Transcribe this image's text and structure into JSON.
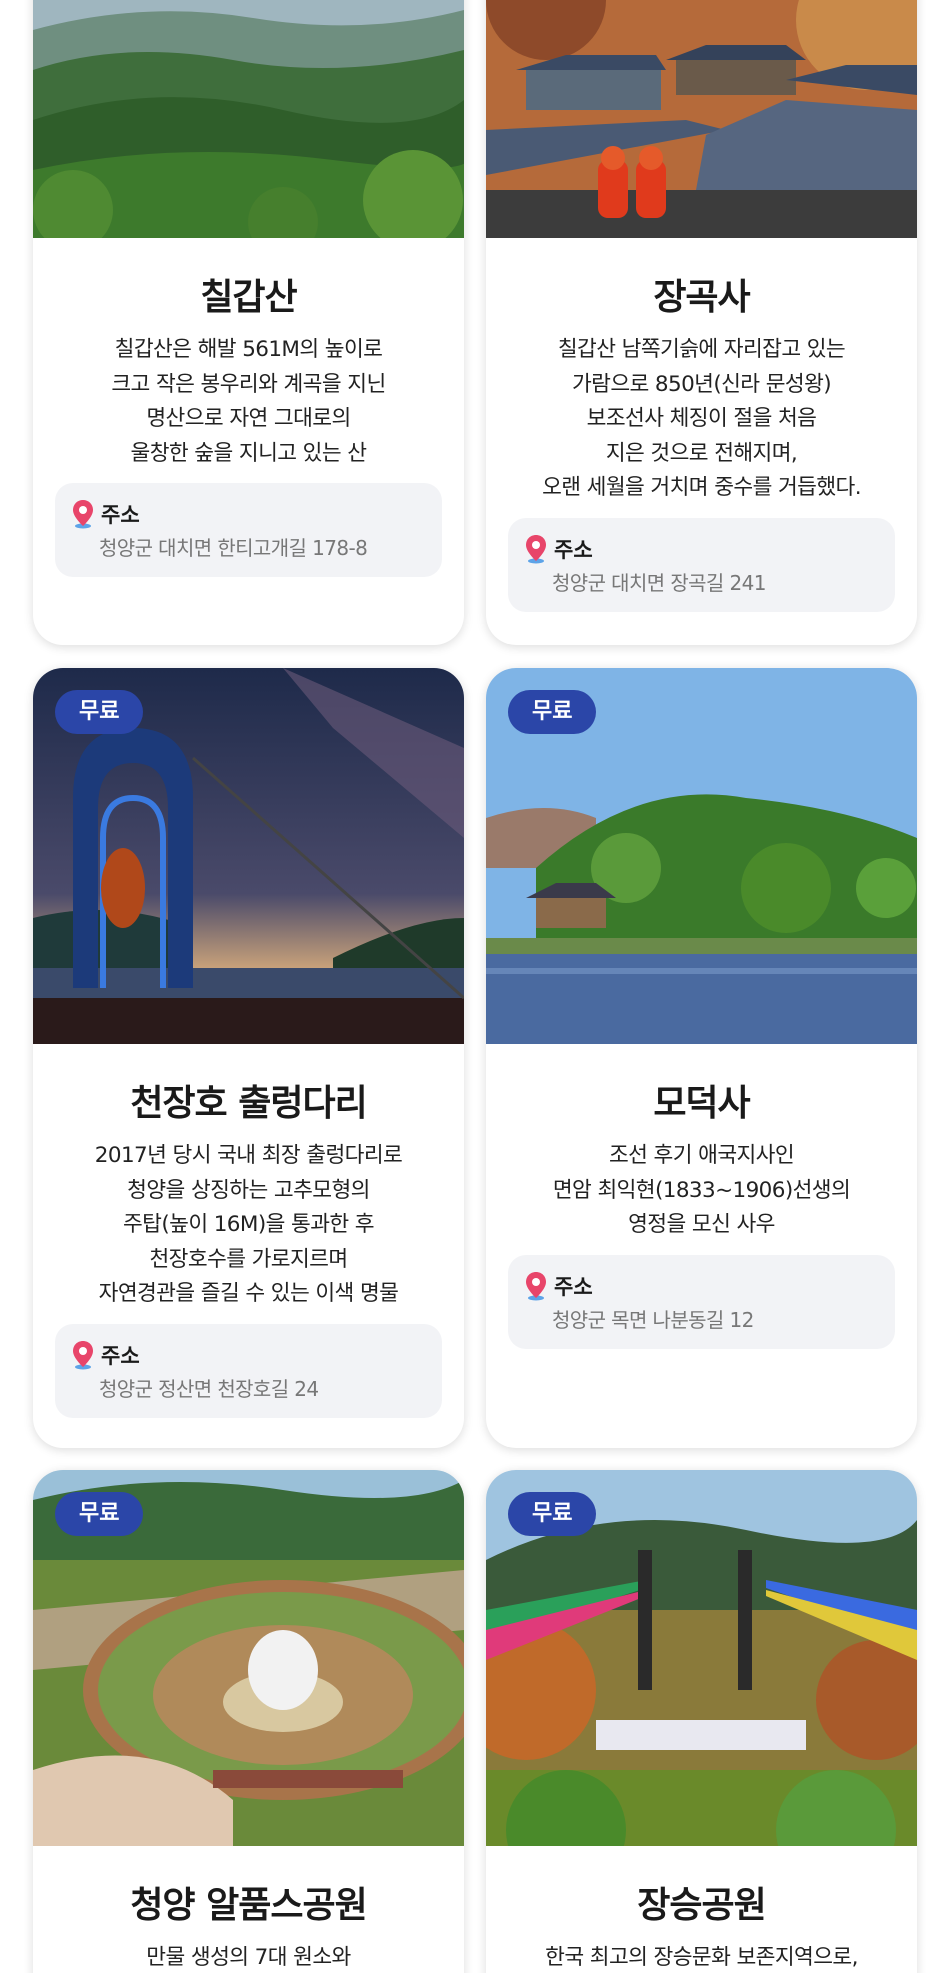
{
  "address_label": "주소",
  "colors": {
    "badge": "#2b46a8",
    "pin": "#e8456a",
    "address_bg": "#f2f3f6"
  },
  "cards": [
    {
      "title": "칠갑산",
      "desc": [
        "칠갑산은 해발 561M의 높이로",
        "크고 작은 봉우리와 계곡을 지닌",
        "명산으로 자연 그대로의",
        "울창한 숲을 지니고 있는 산"
      ],
      "address": "청양군 대치면 한티고개길 178-8"
    },
    {
      "title": "장곡사",
      "desc": [
        "칠갑산 남쪽기슭에 자리잡고 있는",
        "가람으로 850년(신라 문성왕)",
        "보조선사 체징이 절을 처음",
        "지은 것으로 전해지며,",
        "오랜 세월을 거치며 중수를 거듭했다."
      ],
      "address": "청양군 대치면 장곡길 241"
    },
    {
      "badge": "무료",
      "title": "천장호 출렁다리",
      "desc": [
        "2017년 당시 국내 최장 출렁다리로",
        "청양을 상징하는 고추모형의",
        "주탑(높이 16M)을 통과한 후",
        "천장호수를 가로지르며",
        "자연경관을 즐길 수 있는 이색 명물"
      ],
      "address": "청양군 정산면 천장호길 24"
    },
    {
      "badge": "무료",
      "title": "모덕사",
      "desc": [
        "조선 후기 애국지사인",
        "면암 최익현(1833~1906)선생의",
        "영정을 모신 사우"
      ],
      "address": "청양군 목면 나분동길 12"
    },
    {
      "badge": "무료",
      "title": "청양 알품스공원",
      "desc": [
        "만물 생성의 7대 원소와"
      ]
    },
    {
      "badge": "무료",
      "title": "장승공원",
      "desc": [
        "한국 최고의 장승문화 보존지역으로,"
      ]
    }
  ]
}
